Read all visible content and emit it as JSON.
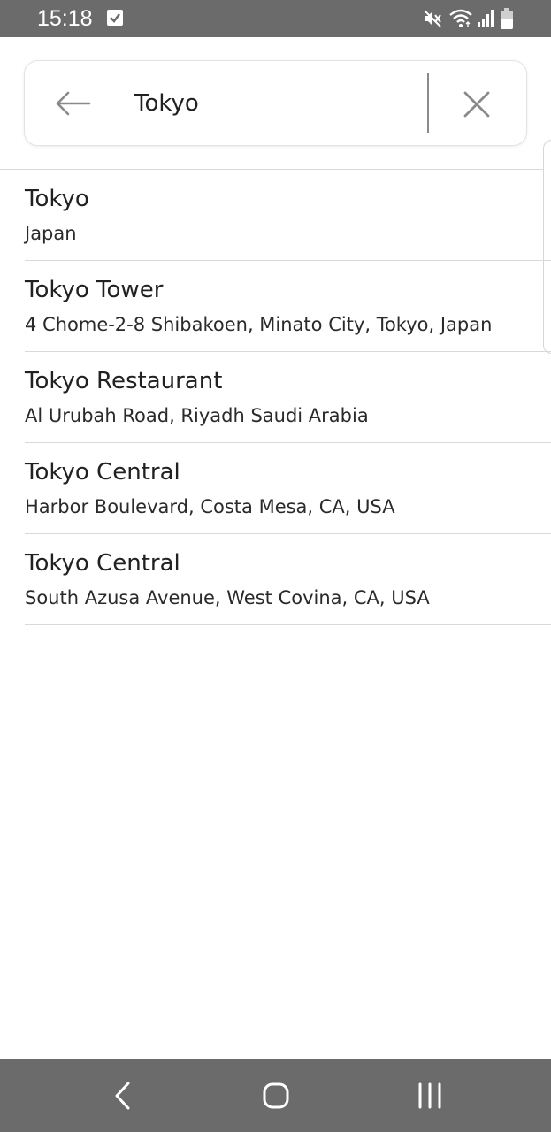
{
  "status_bar": {
    "time": "15:18",
    "icons": [
      "checkbox-notification-icon",
      "mute-icon",
      "wifi-icon",
      "signal-icon",
      "battery-icon"
    ]
  },
  "search": {
    "query": "Tokyo",
    "back_icon": "arrow-left-icon",
    "clear_icon": "close-icon"
  },
  "results": [
    {
      "title": "Tokyo",
      "subtitle": "Japan"
    },
    {
      "title": "Tokyo Tower",
      "subtitle": "4 Chome-2-8 Shibakoen, Minato City, Tokyo, Japan"
    },
    {
      "title": "Tokyo Restaurant",
      "subtitle": "Al Urubah Road, Riyadh Saudi Arabia"
    },
    {
      "title": "Tokyo Central",
      "subtitle": "Harbor Boulevard, Costa Mesa, CA, USA"
    },
    {
      "title": "Tokyo Central",
      "subtitle": "South Azusa Avenue, West Covina, CA, USA"
    }
  ],
  "nav_bar": {
    "buttons": [
      "back-icon",
      "home-icon",
      "recents-icon"
    ]
  },
  "colors": {
    "system_bar": "#6b6b6b",
    "divider": "#d9d9d9",
    "text": "#212121"
  }
}
